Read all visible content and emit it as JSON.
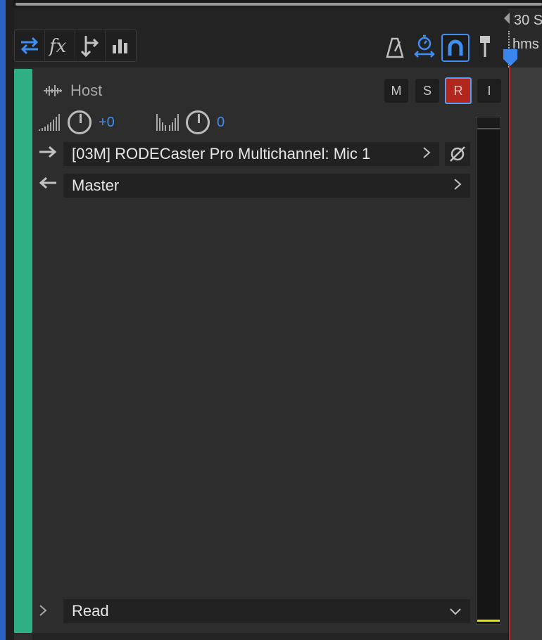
{
  "toolbar": {
    "left_icons": [
      "inputs-outputs-icon",
      "effects-icon",
      "sends-icon",
      "eq-icon"
    ],
    "right_icons": [
      "metronome-icon",
      "time-stretch-icon",
      "snap-magnet-icon",
      "marker-pin-icon"
    ]
  },
  "ruler": {
    "label": "30 S",
    "unit": "hms"
  },
  "track": {
    "name": "Host",
    "buttons": {
      "mute": "M",
      "solo": "S",
      "record": "R",
      "input_monitor": "I"
    },
    "volume": "+0",
    "pan": "0",
    "input": "[03M] RODECaster Pro Multichannel:  Mic 1",
    "output": "Master",
    "automation_mode": "Read"
  },
  "meter": {
    "level": 0.0
  },
  "colors": {
    "track": "#2fb084",
    "accent": "#3f8ff2",
    "record": "#b3261e",
    "playhead": "#b52a2a"
  }
}
